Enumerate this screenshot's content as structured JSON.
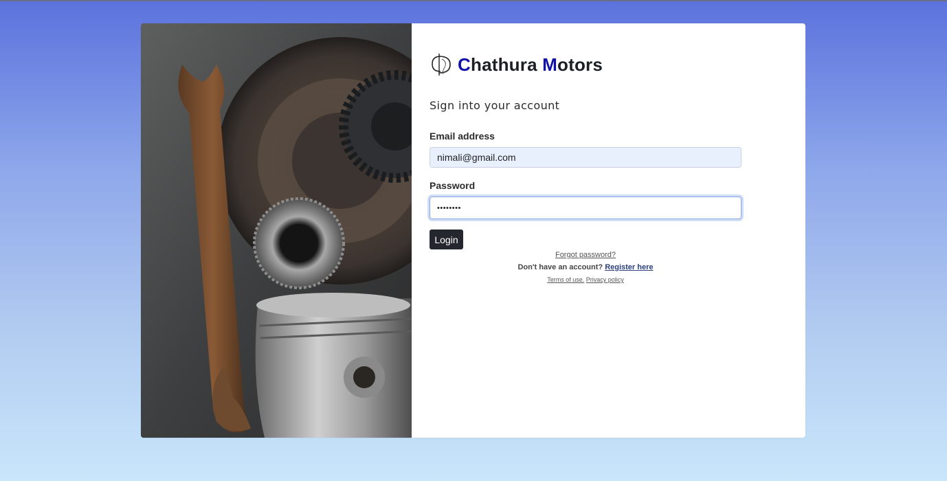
{
  "brand": {
    "name_c": "C",
    "name_rest1": "hathura ",
    "name_m": "M",
    "name_rest2": "otors",
    "accent_color": "#1111aa",
    "logo_icon": "cd-monogram-logo"
  },
  "form": {
    "subtitle": "Sign into your account",
    "email_label": "Email address",
    "email_value": "nimali@gmail.com",
    "password_label": "Password",
    "password_value": "••••••••",
    "login_label": "Login"
  },
  "links": {
    "forgot": "Forgot password?",
    "no_account": "Don't have an account? ",
    "register": "Register here",
    "terms": "Terms of use.",
    "privacy": "Privacy policy"
  },
  "colors": {
    "button_bg": "#24282e",
    "email_field_bg": "#e8f0fd",
    "page_gradient_top": "#5b72dd",
    "page_gradient_bottom": "#c9e6fb"
  }
}
